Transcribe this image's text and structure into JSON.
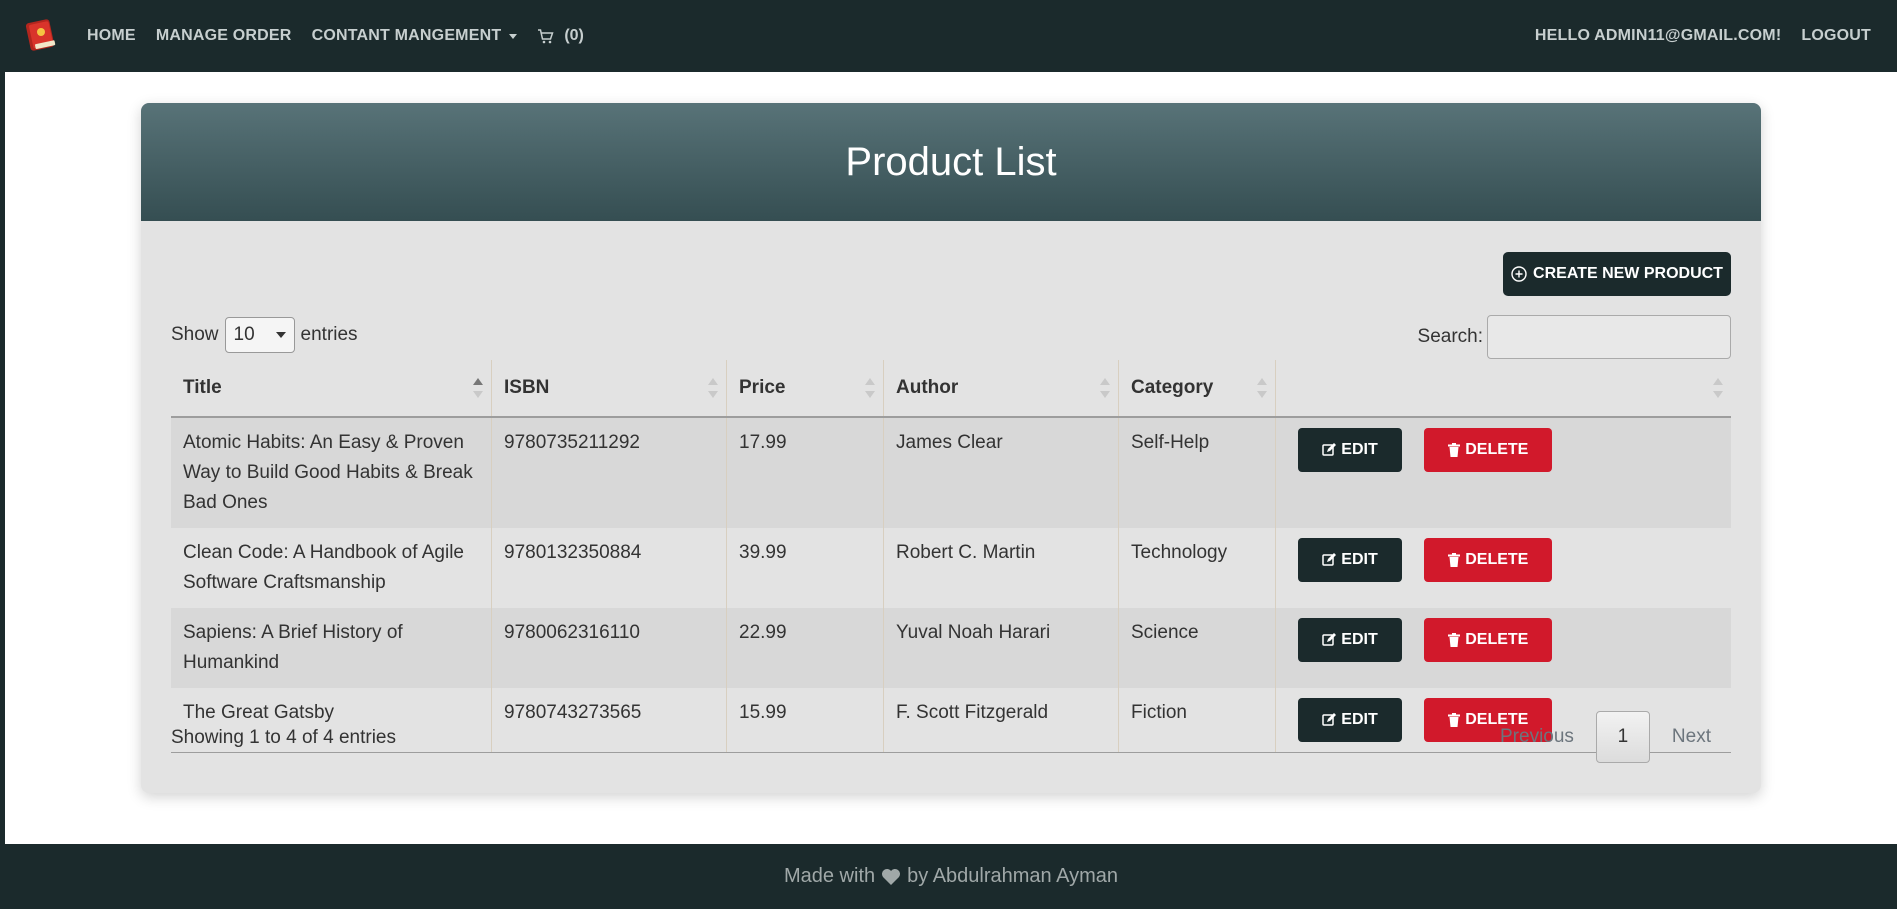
{
  "navbar": {
    "logo_icon": "book-icon",
    "items": [
      {
        "label": "HOME"
      },
      {
        "label": "MANAGE ORDER"
      },
      {
        "label": "CONTANT MANGEMENT"
      }
    ],
    "cart_count": "(0)",
    "greeting": "HELLO ADMIN11@GMAIL.COM!",
    "logout": "LOGOUT"
  },
  "card": {
    "title": "Product List",
    "create_label": "CREATE NEW PRODUCT"
  },
  "table_controls": {
    "show_label": "Show",
    "entries_value": "10",
    "entries_label": "entries",
    "search_label": "Search:",
    "search_value": ""
  },
  "table": {
    "headers": [
      "Title",
      "ISBN",
      "Price",
      "Author",
      "Category"
    ],
    "edit_label": "EDIT",
    "delete_label": "DELETE",
    "rows": [
      {
        "title": "Atomic Habits: An Easy & Proven Way to Build Good Habits & Break Bad Ones",
        "isbn": "9780735211292",
        "price": "17.99",
        "author": "James Clear",
        "category": "Self-Help"
      },
      {
        "title": "Clean Code: A Handbook of Agile Software Craftsmanship",
        "isbn": "9780132350884",
        "price": "39.99",
        "author": "Robert C. Martin",
        "category": "Technology"
      },
      {
        "title": "Sapiens: A Brief History of Humankind",
        "isbn": "9780062316110",
        "price": "22.99",
        "author": "Yuval Noah Harari",
        "category": "Science"
      },
      {
        "title": "The Great Gatsby",
        "isbn": "9780743273565",
        "price": "15.99",
        "author": "F. Scott Fitzgerald",
        "category": "Fiction"
      }
    ]
  },
  "pagination": {
    "info": "Showing 1 to 4 of 4 entries",
    "previous": "Previous",
    "current": "1",
    "next": "Next"
  },
  "footer": {
    "before": "Made with",
    "after": "by Abdulrahman Ayman",
    "icon": "heart-icon"
  },
  "colors": {
    "navbar_bg": "#1b2a2c",
    "header_gradient_top": "#587378",
    "header_gradient_bottom": "#354e52",
    "delete": "#d1192b",
    "card_bg": "#e3e3e3"
  }
}
